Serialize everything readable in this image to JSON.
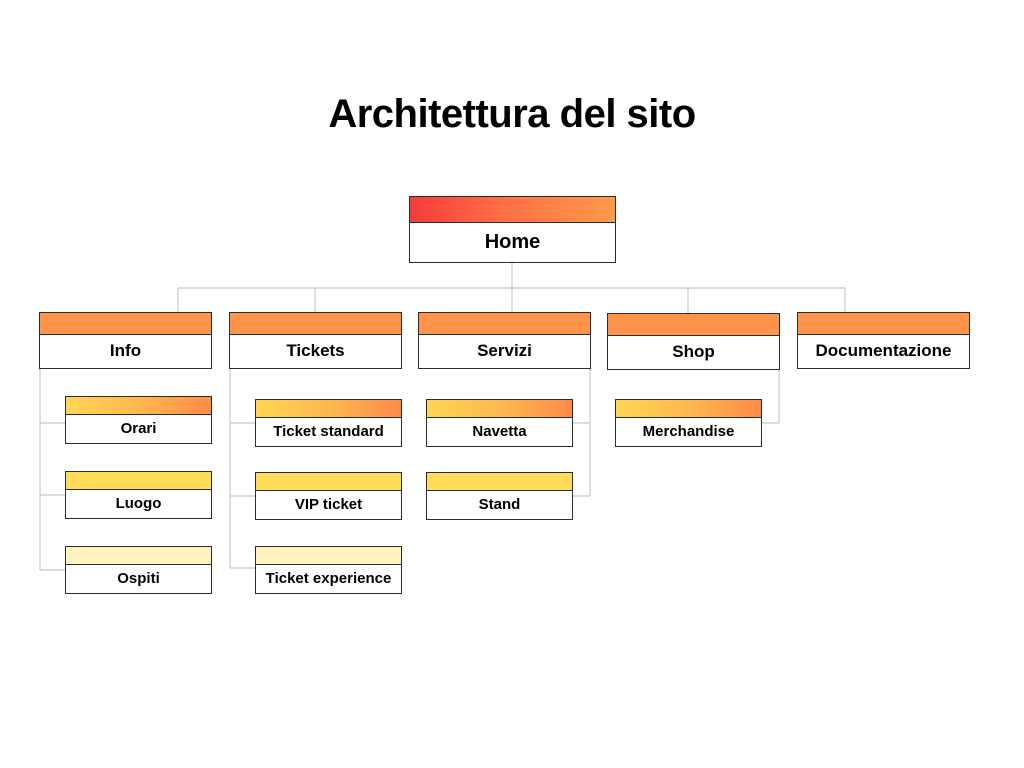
{
  "title": "Architettura del sito",
  "home": {
    "label": "Home"
  },
  "sections": [
    {
      "label": "Info",
      "children": [
        "Orari",
        "Luogo",
        "Ospiti"
      ]
    },
    {
      "label": "Tickets",
      "children": [
        "Ticket standard",
        "VIP ticket",
        "Ticket experience"
      ]
    },
    {
      "label": "Servizi",
      "children": [
        "Navetta",
        "Stand"
      ]
    },
    {
      "label": "Shop",
      "children": [
        "Merchandise"
      ]
    },
    {
      "label": "Documentazione",
      "children": []
    }
  ],
  "colors": {
    "home_bar": "#f63c3c",
    "section_bar": "#ff934a",
    "subpage_bar_first": "#ffb84f",
    "subpage_bar_second": "#ffdd5a",
    "subpage_bar_third": "#fff3c0",
    "connector": "#c8c8c8",
    "border": "#2b2b2b"
  }
}
